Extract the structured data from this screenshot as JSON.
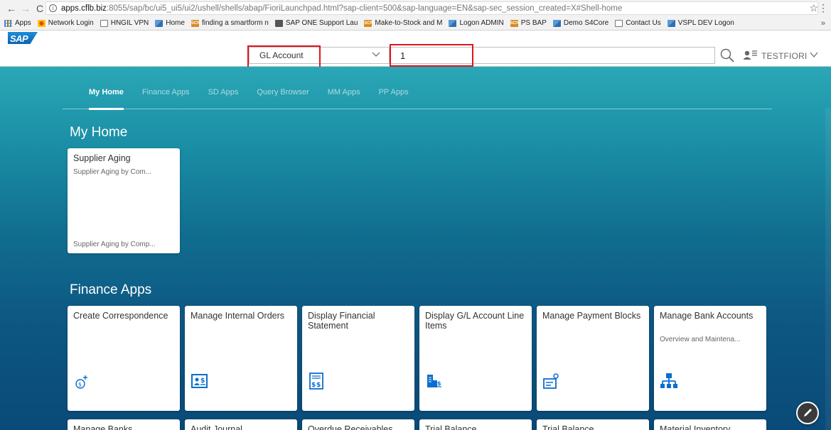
{
  "browser": {
    "url_host": "apps.cflb.biz",
    "url_rest": ":8055/sap/bc/ui5_ui5/ui2/ushell/shells/abap/FioriLaunchpad.html?sap-client=500&sap-language=EN&sap-sec_session_created=X#Shell-home",
    "bookmarks": [
      {
        "label": "Apps",
        "icon": "apps-grid-icon"
      },
      {
        "label": "Network Login",
        "icon": "network-icon"
      },
      {
        "label": "HNGIL VPN",
        "icon": "page-icon"
      },
      {
        "label": "Home",
        "icon": "sap-icon"
      },
      {
        "label": "finding a smartform n",
        "icon": "scn-icon"
      },
      {
        "label": "SAP ONE Support Lau",
        "icon": "ibm-icon"
      },
      {
        "label": "Make-to-Stock and M",
        "icon": "scn-icon"
      },
      {
        "label": "Logon ADMIN",
        "icon": "sap-icon"
      },
      {
        "label": "PS BAP",
        "icon": "scn-icon"
      },
      {
        "label": "Demo S4Core",
        "icon": "sap-icon"
      },
      {
        "label": "Contact Us",
        "icon": "page-icon"
      },
      {
        "label": "VSPL DEV Logon",
        "icon": "sap-icon"
      }
    ],
    "more": "»"
  },
  "shell": {
    "logo": "SAP",
    "search_scope": "GL Account",
    "search_value": "1",
    "user_name": "TESTFIORI"
  },
  "tabs": [
    "My Home",
    "Finance Apps",
    "SD Apps",
    "Query Browser",
    "MM Apps",
    "PP Apps"
  ],
  "groups": {
    "my_home": {
      "title": "My Home",
      "tiles": [
        {
          "title": "Supplier Aging",
          "subtitle": "Supplier Aging by Com...",
          "footer": "Supplier Aging by Comp..."
        }
      ]
    },
    "finance": {
      "title": "Finance Apps",
      "tiles": [
        {
          "title": "Create Correspondence",
          "subtitle": "",
          "icon": "correspondence-icon"
        },
        {
          "title": "Manage Internal Orders",
          "subtitle": "",
          "icon": "internal-order-icon"
        },
        {
          "title": "Display Financial Statement",
          "subtitle": "",
          "icon": "financial-statement-icon"
        },
        {
          "title": "Display G/L Account Line Items",
          "subtitle": "",
          "icon": "gl-line-items-icon"
        },
        {
          "title": "Manage Payment Blocks",
          "subtitle": "",
          "icon": "payment-block-icon"
        },
        {
          "title": "Manage Bank Accounts",
          "subtitle": "Overview and Maintena...",
          "icon": "org-hierarchy-icon"
        }
      ],
      "row2": [
        "Manage Banks",
        "Audit Journal",
        "Overdue Receivables",
        "Trial Balance",
        "Trial Balance",
        "Material Inventory"
      ]
    }
  },
  "colors": {
    "shell_accent": "#0a6ed1",
    "highlight": "#e0141e",
    "launchpad_top": "#2aa7b6",
    "launchpad_bottom": "#0a4a78"
  }
}
